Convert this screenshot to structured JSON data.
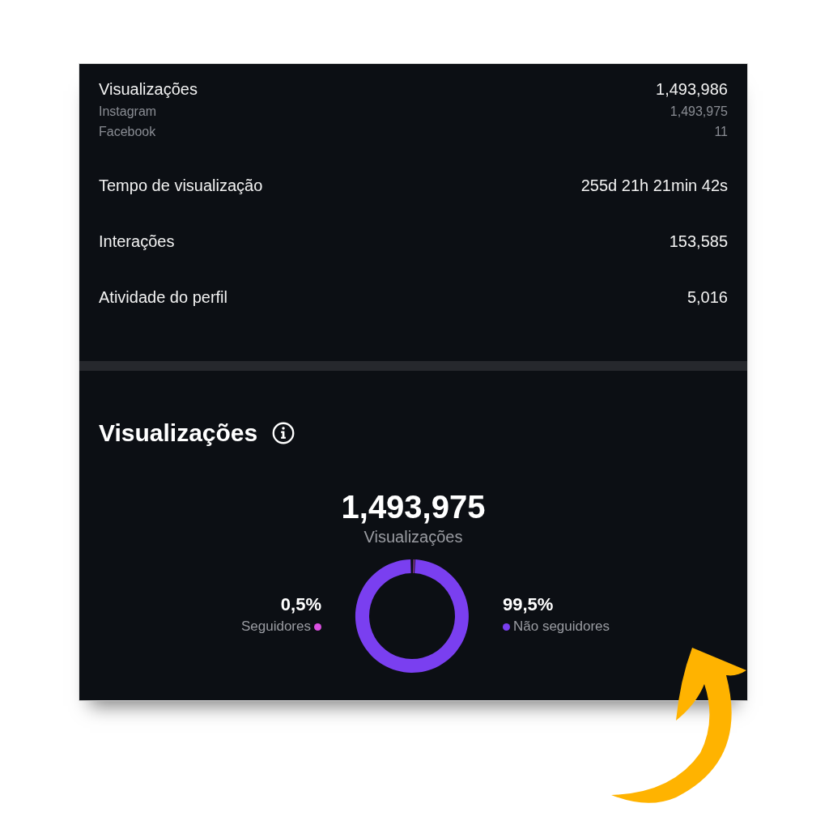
{
  "summary": {
    "rows": [
      {
        "label": "Visualizações",
        "value": "1,493,986",
        "breakdown": [
          {
            "label": "Instagram",
            "value": "1,493,975"
          },
          {
            "label": "Facebook",
            "value": "11"
          }
        ]
      },
      {
        "label": "Tempo de visualização",
        "value": "255d 21h 21min 42s"
      },
      {
        "label": "Interações",
        "value": "153,585"
      },
      {
        "label": "Atividade do perfil",
        "value": "5,016"
      }
    ]
  },
  "views": {
    "title": "Visualizações",
    "total": "1,493,975",
    "total_label": "Visualizações",
    "segments": [
      {
        "percent": "0,5%",
        "color": "#d94fe0"
      },
      {
        "percent": "99,5%",
        "color": "#7a3ff0"
      }
    ],
    "chart_data": {
      "type": "donut",
      "categories": [
        "Seguidores",
        "Não seguidores"
      ],
      "values": [
        0.5,
        99.5
      ]
    }
  }
}
